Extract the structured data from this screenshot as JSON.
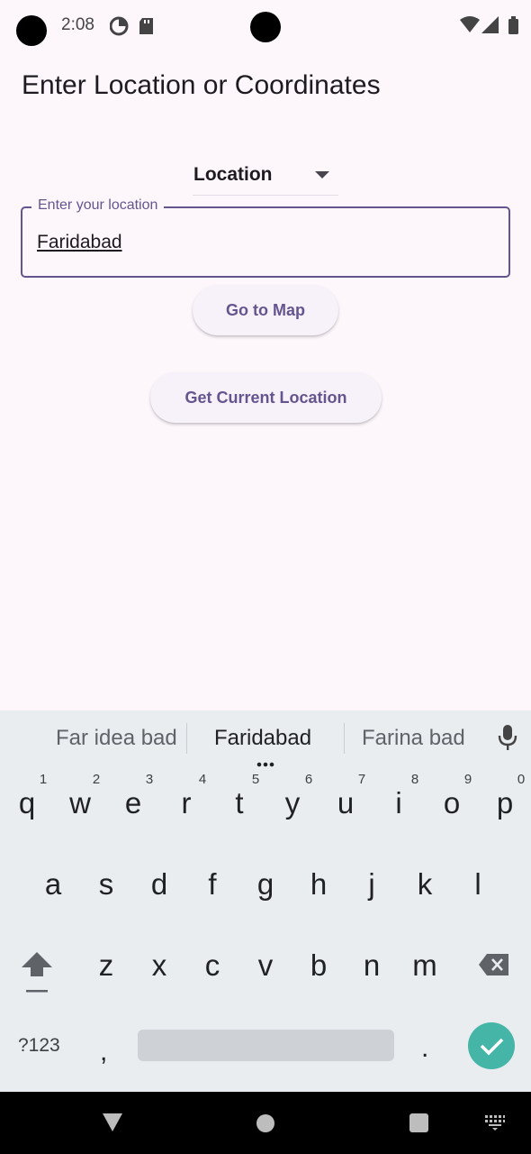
{
  "status_bar": {
    "time": "2:08"
  },
  "page": {
    "title": "Enter Location or Coordinates"
  },
  "dropdown": {
    "selected": "Location"
  },
  "location_field": {
    "label": "Enter your location",
    "value": "Faridabad"
  },
  "buttons": {
    "go_to_map": "Go to Map",
    "get_current_location": "Get Current Location"
  },
  "keyboard": {
    "suggestions": [
      "Far idea bad",
      "Faridabad",
      "Farina bad"
    ],
    "row1": [
      "q",
      "w",
      "e",
      "r",
      "t",
      "y",
      "u",
      "i",
      "o",
      "p"
    ],
    "row1_numbers": [
      "1",
      "2",
      "3",
      "4",
      "5",
      "6",
      "7",
      "8",
      "9",
      "0"
    ],
    "row2": [
      "a",
      "s",
      "d",
      "f",
      "g",
      "h",
      "j",
      "k",
      "l"
    ],
    "row3": [
      "z",
      "x",
      "c",
      "v",
      "b",
      "n",
      "m"
    ],
    "symbols_key": "?123",
    "comma_key": ",",
    "period_key": "."
  },
  "colors": {
    "background": "#fdf7fc",
    "accent": "#65558f",
    "keyboard_bg": "#e9edf0",
    "enter_key": "#45b5a7"
  }
}
